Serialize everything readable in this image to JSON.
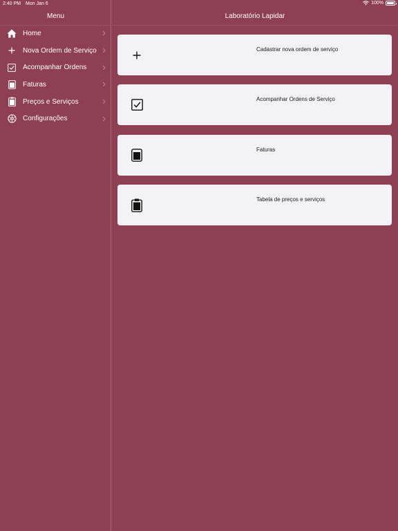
{
  "status_bar": {
    "time": "2:40 PM",
    "date": "Mon Jan 6",
    "battery": "100%"
  },
  "sidebar": {
    "title": "Menu",
    "items": [
      {
        "label": "Home",
        "icon": "home-icon"
      },
      {
        "label": "Nova Ordem de Serviço",
        "icon": "plus-icon"
      },
      {
        "label": "Acompanhar Ordens",
        "icon": "checkbox-icon"
      },
      {
        "label": "Faturas",
        "icon": "invoice-icon"
      },
      {
        "label": "Preços e Serviços",
        "icon": "clipboard-icon"
      },
      {
        "label": "Configurações",
        "icon": "settings-icon"
      }
    ]
  },
  "main": {
    "title": "Laboratório Lapidar",
    "cards": [
      {
        "label": "Cadastrar nova ordem de serviço",
        "icon": "plus-icon"
      },
      {
        "label": "Acompanhar Ordens de Serviço",
        "icon": "checkbox-icon"
      },
      {
        "label": "Faturas",
        "icon": "invoice-icon"
      },
      {
        "label": "Tabela de preços e serviços",
        "icon": "clipboard-icon"
      }
    ]
  },
  "colors": {
    "background": "#8e3f52",
    "card": "#f3f3f7",
    "text": "#ffffff"
  }
}
